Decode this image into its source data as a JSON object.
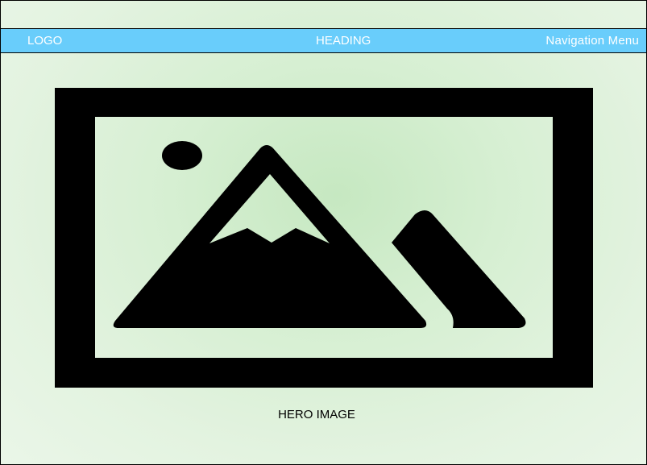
{
  "header": {
    "logo_label": "LOGO",
    "heading_label": "HEADING",
    "nav_label": "Navigation Menu",
    "background_color": "#69cdfb",
    "text_color": "#ffffff"
  },
  "hero": {
    "icon": "image-placeholder-icon",
    "caption": "HERO IMAGE"
  },
  "colors": {
    "page_background": "#d6efd2",
    "hero_fill": "#c6e8c1"
  }
}
